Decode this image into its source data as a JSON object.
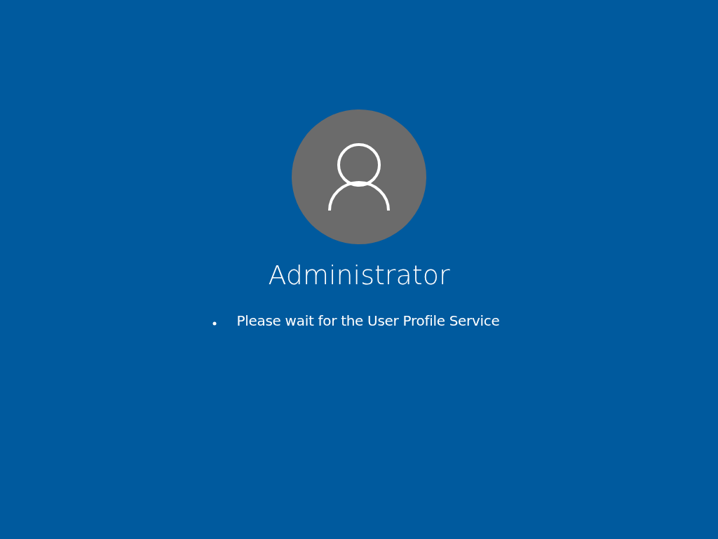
{
  "user": {
    "name": "Administrator"
  },
  "status": {
    "message": "Please wait for the User Profile Service"
  }
}
